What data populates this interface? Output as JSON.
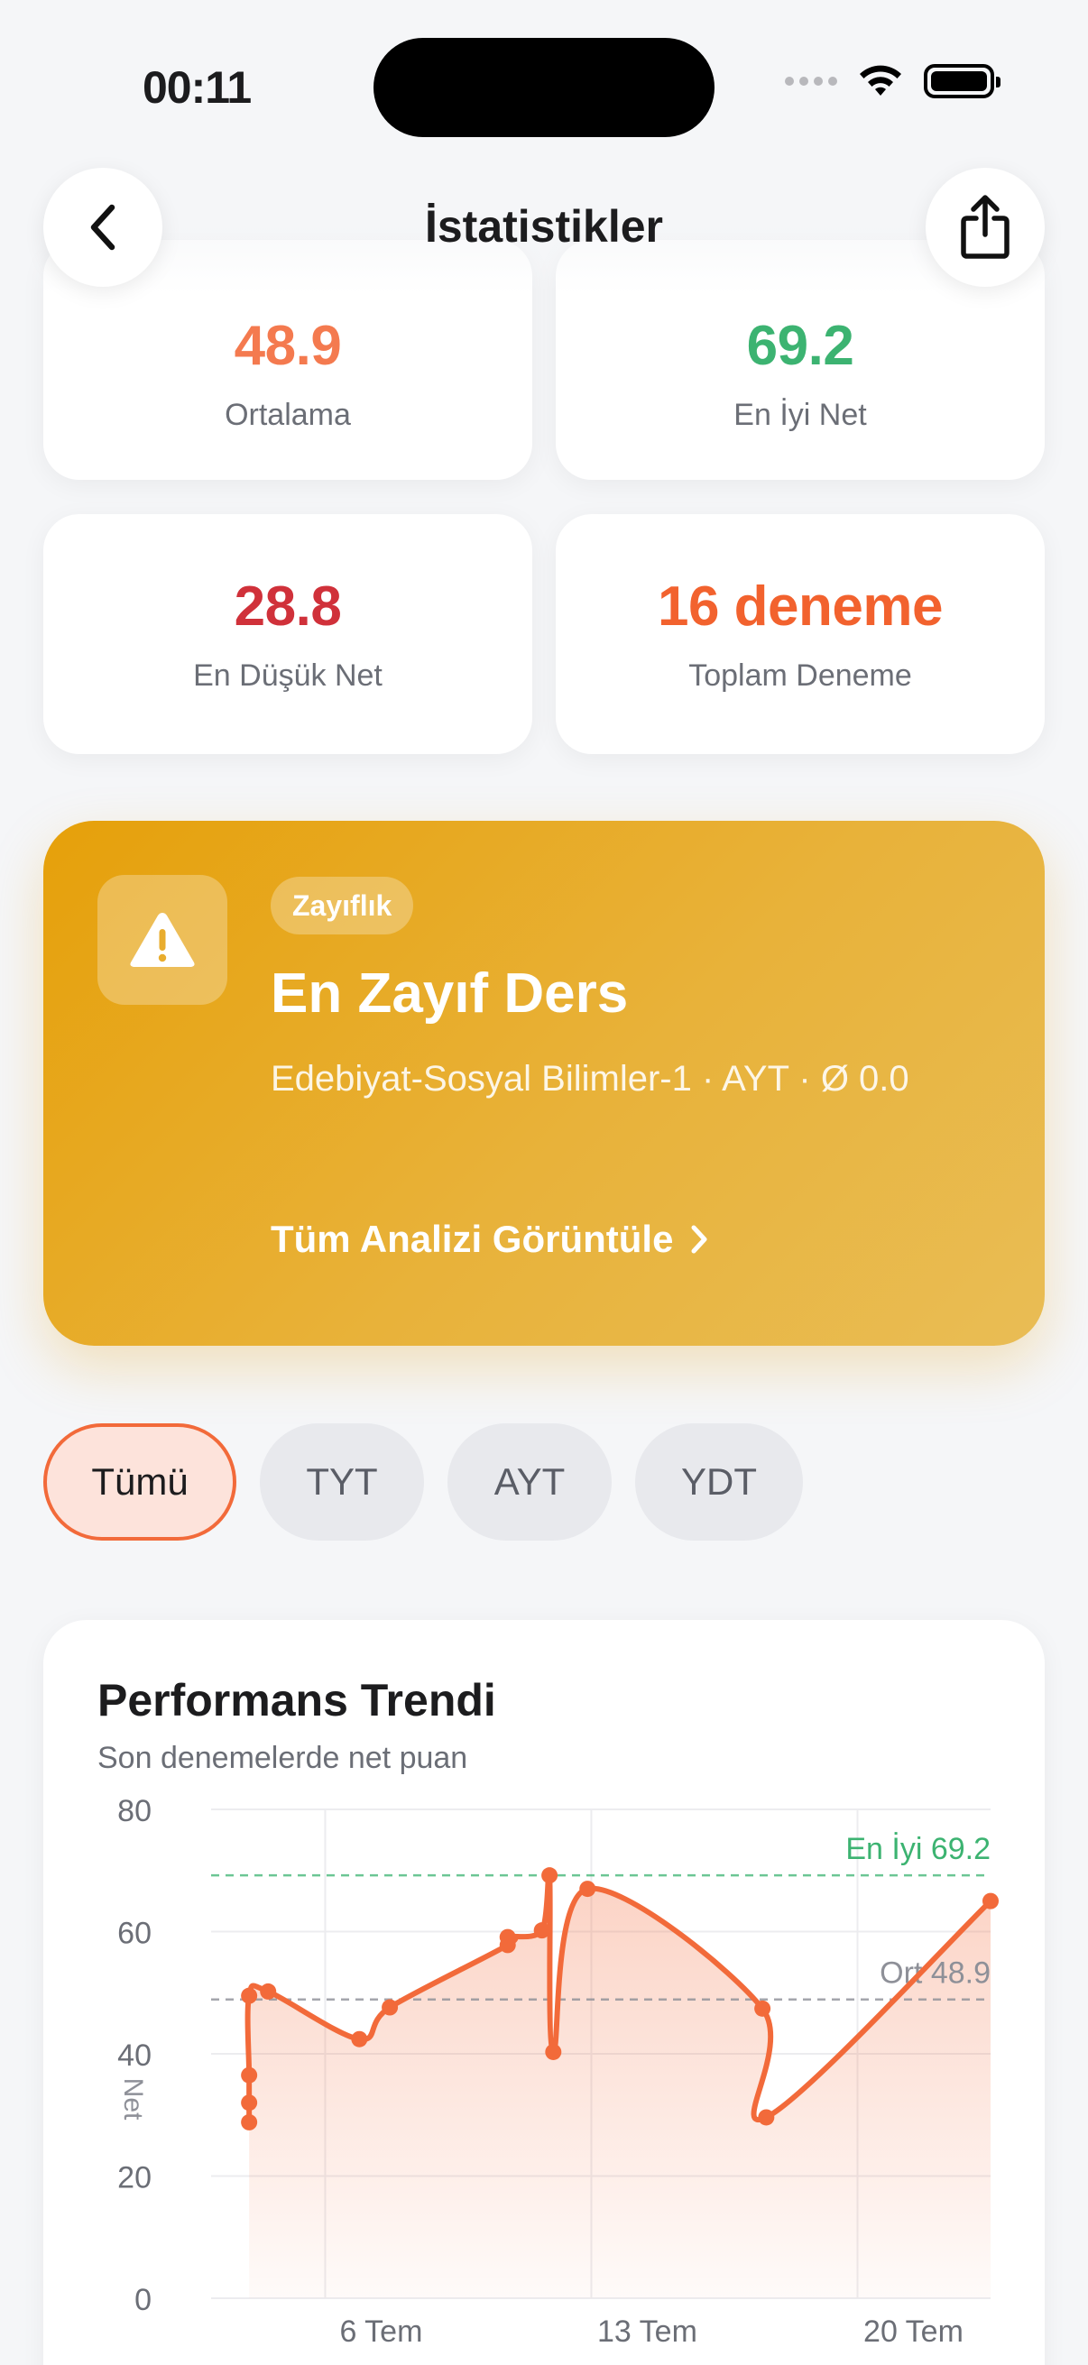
{
  "status": {
    "time": "00:11"
  },
  "nav": {
    "title": "İstatistikler"
  },
  "stats": [
    {
      "value": "48.9",
      "label": "Ortalama",
      "color": "#f47a4f"
    },
    {
      "value": "69.2",
      "label": "En İyi Net",
      "color": "#3cb371"
    },
    {
      "value": "28.8",
      "label": "En Düşük Net",
      "color": "#d0313a"
    },
    {
      "value": "16 deneme",
      "label": "Toplam Deneme",
      "color": "#f2622e"
    }
  ],
  "weakness": {
    "badge": "Zayıflık",
    "title": "En Zayıf Ders",
    "detail": "Edebiyat-Sosyal Bilimler-1 · AYT · Ø 0.0",
    "link": "Tüm Analizi Görüntüle"
  },
  "filters": [
    {
      "label": "Tümü",
      "active": true
    },
    {
      "label": "TYT",
      "active": false
    },
    {
      "label": "AYT",
      "active": false
    },
    {
      "label": "YDT",
      "active": false
    }
  ],
  "colors": {
    "accent": "#f26a3a",
    "best": "#3cb371",
    "average": "#8e9098"
  },
  "chart_data": {
    "type": "line",
    "title": "Performans Trendi",
    "subtitle": "Son denemelerde net puan",
    "ylabel": "Net",
    "ylim": [
      0,
      80
    ],
    "yticks": [
      0,
      20,
      40,
      60,
      80
    ],
    "xlim": [
      3,
      23.5
    ],
    "xticks": [
      {
        "value": 6,
        "label": "6 Tem"
      },
      {
        "value": 13,
        "label": "13 Tem"
      },
      {
        "value": 20,
        "label": "20 Tem"
      }
    ],
    "series": [
      {
        "x": [
          4.0,
          4.0,
          4.0,
          4.0,
          4.5,
          6.9,
          7.7,
          10.8,
          10.8,
          11.7,
          11.9,
          12.0,
          12.9,
          17.5,
          17.6,
          23.5
        ],
        "y": [
          28.8,
          32,
          36.5,
          49.5,
          50.2,
          42.4,
          47.6,
          57.8,
          59.1,
          60.2,
          69.2,
          40.3,
          67.0,
          47.4,
          29.6,
          65.0
        ]
      }
    ],
    "reference_lines": [
      {
        "label": "En İyi 69.2",
        "value": 69.2
      },
      {
        "label": "Ort 48.9",
        "value": 48.9
      }
    ]
  }
}
